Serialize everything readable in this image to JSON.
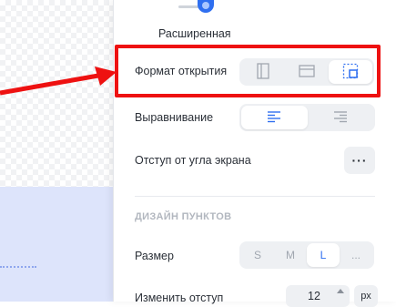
{
  "colors": {
    "accent": "#2f6ff0",
    "highlight": "#ee1111",
    "section_title": "#b2b7bf"
  },
  "slider": {
    "caption": "Расширенная"
  },
  "open_format": {
    "label": "Формат открытия",
    "options": [
      {
        "icon": "panel-vertical-icon",
        "active": false
      },
      {
        "icon": "panel-horizontal-icon",
        "active": false
      },
      {
        "icon": "panel-corner-icon",
        "active": true
      }
    ]
  },
  "alignment": {
    "label": "Выравнивание",
    "options": [
      {
        "icon": "align-left-icon",
        "active": true
      },
      {
        "icon": "align-right-icon",
        "active": false
      }
    ]
  },
  "corner_offset": {
    "label": "Отступ от угла экрана",
    "button_label": "···"
  },
  "items_design": {
    "title": "ДИЗАЙН ПУНКТОВ",
    "size_label": "Размер",
    "sizes": [
      "S",
      "M",
      "L",
      "..."
    ],
    "selected_size": "L"
  },
  "indent": {
    "label": "Изменить отступ",
    "value": "12",
    "unit": "px"
  }
}
